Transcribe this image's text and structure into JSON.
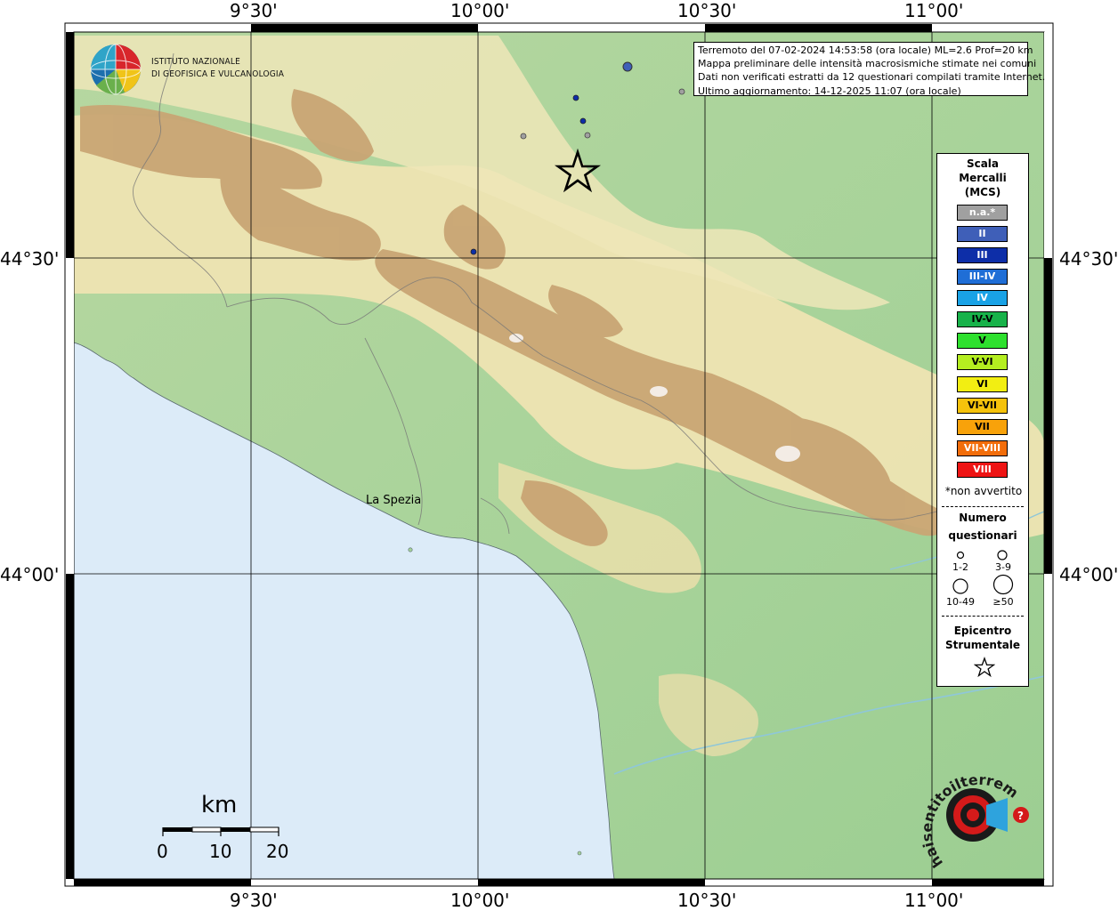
{
  "axes": {
    "top_ticks": [
      "9°30'",
      "10°00'",
      "10°30'",
      "11°00'"
    ],
    "bottom_ticks": [
      "9°30'",
      "10°00'",
      "10°30'",
      "11°00'"
    ],
    "left_ticks": [
      "44°30'",
      "44°00'"
    ],
    "right_ticks": [
      "44°30'",
      "44°00'"
    ]
  },
  "info_box": {
    "line1": "Terremoto del 07-02-2024 14:53:58 (ora locale) ML=2.6 Prof=20 km",
    "line2": "Mappa preliminare delle intensità macrosismiche stimate nei comuni",
    "line3": "Dati non verificati estratti da 12 questionari compilati tramite Internet.",
    "line4": "Ultimo aggiornamento: 14-12-2025 11:07 (ora locale)"
  },
  "logo_ingv": {
    "line1": "ISTITUTO NAZIONALE",
    "line2": "DI GEOFISICA E VULCANOLOGIA"
  },
  "logo_hsit": {
    "text": "haisentitoilterremoto.it www.",
    "accent_color": "#d41a1a"
  },
  "place_label": "La Spezia",
  "scale_bar": {
    "unit": "km",
    "labels": [
      "0",
      "10",
      "20"
    ]
  },
  "legend": {
    "title_lines": [
      "Scala",
      "Mercalli",
      "(MCS)"
    ],
    "classes": [
      {
        "label": "n.a.*",
        "color": "#a0a0a0",
        "text_color": "#ffffff"
      },
      {
        "label": "II",
        "color": "#3f5fb8",
        "text_color": "#ffffff"
      },
      {
        "label": "III",
        "color": "#0d2ea8",
        "text_color": "#ffffff"
      },
      {
        "label": "III-IV",
        "color": "#1f6ed6",
        "text_color": "#ffffff"
      },
      {
        "label": "IV",
        "color": "#19a2e6",
        "text_color": "#ffffff"
      },
      {
        "label": "IV-V",
        "color": "#18b24a",
        "text_color": "#000000"
      },
      {
        "label": "V",
        "color": "#2ee02e",
        "text_color": "#000000"
      },
      {
        "label": "V-VI",
        "color": "#b4ee20",
        "text_color": "#000000"
      },
      {
        "label": "VI",
        "color": "#f2ee12",
        "text_color": "#000000"
      },
      {
        "label": "VI-VII",
        "color": "#f5c20c",
        "text_color": "#000000"
      },
      {
        "label": "VII",
        "color": "#f8a20a",
        "text_color": "#000000"
      },
      {
        "label": "VII-VIII",
        "color": "#f26d0a",
        "text_color": "#ffffff"
      },
      {
        "label": "VIII",
        "color": "#ee1414",
        "text_color": "#ffffff"
      }
    ],
    "not_felt_note": "*non avvertito",
    "count_title_lines": [
      "Numero",
      "questionari"
    ],
    "count_sizes": [
      "1-2",
      "3-9",
      "10-49",
      "≥50"
    ],
    "epicenter_title_lines": [
      "Epicentro",
      "Strumentale"
    ]
  },
  "observations": [
    {
      "class": "II",
      "count": "3-9"
    },
    {
      "class": "III",
      "count": "1-2"
    },
    {
      "class": "III",
      "count": "1-2"
    },
    {
      "class": "III",
      "count": "1-2"
    },
    {
      "class": "n.a.*",
      "count": "1-2"
    },
    {
      "class": "n.a.*",
      "count": "1-2"
    },
    {
      "class": "n.a.*",
      "count": "1-2"
    }
  ],
  "colors": {
    "sea": "#dcebf8",
    "lowland": "#9fcf95",
    "hills": "#eee4b0",
    "mountains": "#c4a070",
    "peaks": "#f4eeea"
  }
}
